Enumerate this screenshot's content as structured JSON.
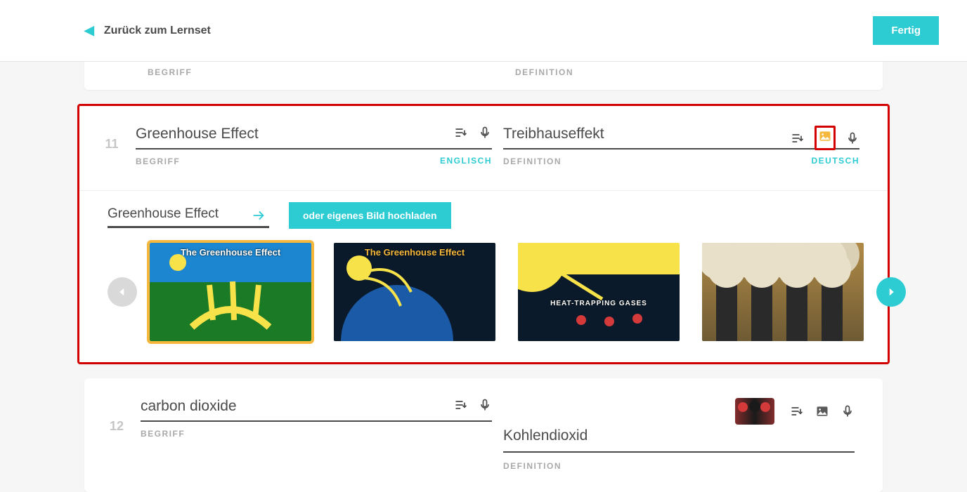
{
  "header": {
    "back_label": "Zurück zum Lernset",
    "done_label": "Fertig"
  },
  "labels": {
    "term": "BEGRIFF",
    "definition": "DEFINITION",
    "lang_term": "ENGLISCH",
    "lang_def": "DEUTSCH"
  },
  "card11": {
    "number": "11",
    "term": "Greenhouse Effect",
    "definition": "Treibhauseffekt",
    "image_search": {
      "query": "Greenhouse Effect",
      "upload_label": "oder eigenes Bild hochladen",
      "thumb_titles": [
        "The Greenhouse Effect",
        "The Greenhouse Effect",
        "HEAT-TRAPPING GASES",
        ""
      ]
    }
  },
  "card12": {
    "number": "12",
    "term": "carbon dioxide",
    "definition": "Kohlendioxid"
  }
}
